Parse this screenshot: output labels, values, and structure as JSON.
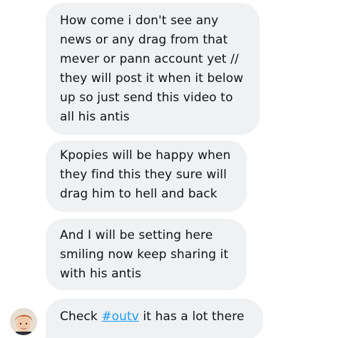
{
  "messages": [
    {
      "lines": [
        "How come i don't see any",
        "news or any drag from that",
        "mever or pann account yet //",
        "they will post it when it below",
        "up so just send this video to",
        "all his antis"
      ]
    },
    {
      "lines": [
        "Kpopies will be happy when",
        "they find this they sure will",
        "drag him to hell and back"
      ]
    },
    {
      "lines": [
        "And I will be setting here",
        "smiling now keep sharing it",
        "with his antis"
      ]
    },
    {
      "prefix": "Check ",
      "hashtag": "#outv",
      "suffix": " it has a lot there"
    }
  ],
  "colors": {
    "bubble_bg": "#eff1f3",
    "text": "#0f1419",
    "link": "#1d9bf0"
  },
  "icons": {
    "avatar": "sender-avatar-icon"
  }
}
